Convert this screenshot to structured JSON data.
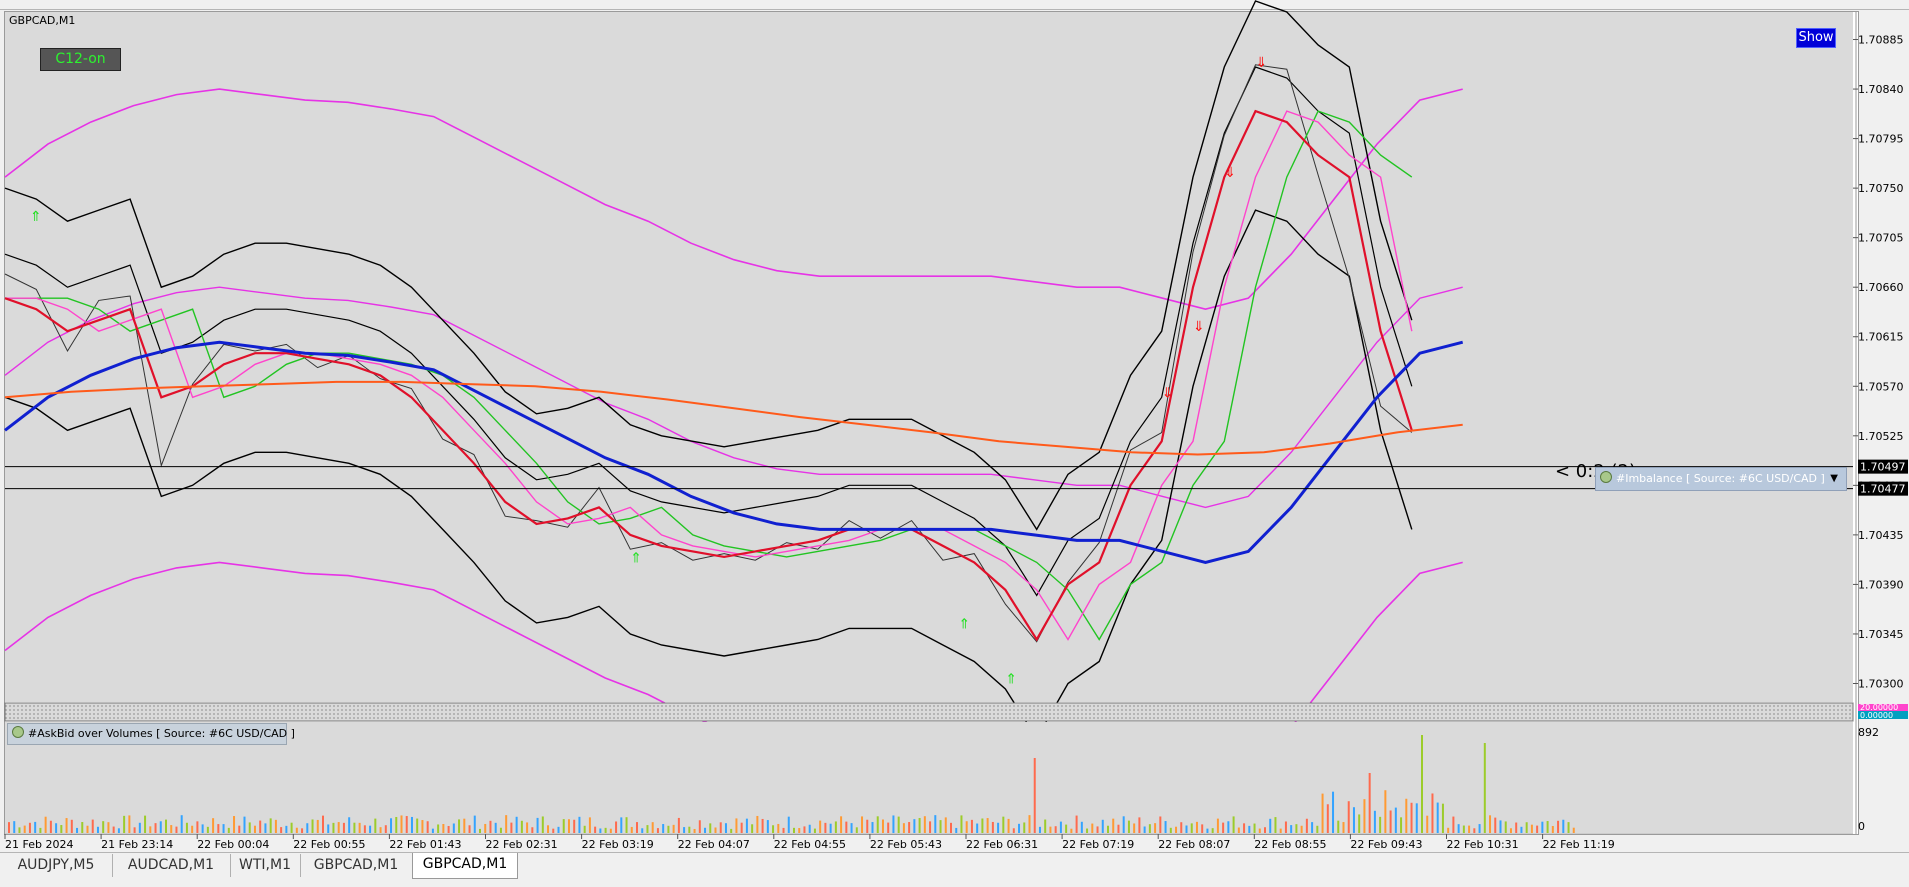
{
  "window": {
    "symbol_title": "GBPCAD,M1"
  },
  "buttons": {
    "c12": "C12-on",
    "show": "Show"
  },
  "indicators": {
    "imbalance_label": "#Imbalance [ Source: #6C USD/CAD ]",
    "imbalance_text": "< 0:2 (2)",
    "subwindow_label": "#AskBid over Volumes [ Source: #6C USD/CAD ]",
    "subwindow_scale_max": "892",
    "subwindow_scale_min": "0",
    "strip_labels": [
      "20.00000",
      "0.00000"
    ]
  },
  "price_labels": {
    "bid": "1.70497",
    "ask": "1.70477"
  },
  "tabs": [
    {
      "label": "AUDJPY,M5",
      "active": false
    },
    {
      "label": "AUDCAD,M1",
      "active": false
    },
    {
      "label": "WTI,M1",
      "active": false
    },
    {
      "label": "GBPCAD,M1",
      "active": false
    },
    {
      "label": "GBPCAD,M1",
      "active": true
    }
  ],
  "colors": {
    "bollinger_outer": "#e633e6",
    "bollinger_inner": "#000000",
    "ma_blue": "#1020d0",
    "ma_orange": "#ff5a1a",
    "ma_red": "#e0102a",
    "ma_green": "#22c422",
    "ma_pink": "#ff44cc",
    "arrow_up": "#22e022",
    "arrow_down": "#ff1010",
    "price_line": "#000000"
  },
  "chart_data": {
    "type": "line",
    "title": "GBPCAD,M1",
    "xlabel": "",
    "ylabel": "",
    "ylim": [
      1.70285,
      1.7091
    ],
    "y_ticks": [
      "1.70885",
      "1.70840",
      "1.70795",
      "1.70750",
      "1.70705",
      "1.70660",
      "1.70615",
      "1.70570",
      "1.70525",
      "1.70480",
      "1.70435",
      "1.70390",
      "1.70345",
      "1.70300"
    ],
    "x_ticks": [
      "21 Feb 2024",
      "21 Feb 23:14",
      "22 Feb 00:04",
      "22 Feb 00:55",
      "22 Feb 01:43",
      "22 Feb 02:31",
      "22 Feb 03:19",
      "22 Feb 04:07",
      "22 Feb 04:55",
      "22 Feb 05:43",
      "22 Feb 06:31",
      "22 Feb 07:19",
      "22 Feb 08:07",
      "22 Feb 08:55",
      "22 Feb 09:43",
      "22 Feb 10:31",
      "22 Feb 11:19"
    ],
    "x_index": [
      0,
      4,
      8,
      12,
      16,
      20,
      24,
      28,
      32,
      36,
      40,
      44,
      48,
      52,
      56,
      60,
      64
    ],
    "grid": false,
    "horizontal_lines": [
      1.70497,
      1.70477
    ],
    "series": [
      {
        "name": "price",
        "values": [
          1.7068,
          1.7065,
          1.7061,
          1.7064,
          1.7066,
          1.7049,
          1.7058,
          1.706,
          1.7061,
          1.706,
          1.70595,
          1.7059,
          1.70585,
          1.7056,
          1.7053,
          1.705,
          1.7046,
          1.7044,
          1.7045,
          1.7047,
          1.7043,
          1.7042,
          1.7042,
          1.7041,
          1.7042,
          1.7042,
          1.7043,
          1.7044,
          1.7044,
          1.7044,
          1.7042,
          1.7041,
          1.7038,
          1.7033,
          1.704,
          1.7042,
          1.7052,
          1.7052,
          1.707,
          1.7079,
          1.7087,
          1.7085,
          1.7077,
          1.7066,
          1.7056,
          1.7052
        ]
      },
      {
        "name": "ma_red",
        "values": [
          1.7065,
          1.7064,
          1.7062,
          1.7063,
          1.7064,
          1.7056,
          1.7057,
          1.7059,
          1.706,
          1.706,
          1.70595,
          1.7059,
          1.7058,
          1.7056,
          1.7053,
          1.705,
          1.70465,
          1.70445,
          1.7045,
          1.7046,
          1.70435,
          1.70425,
          1.7042,
          1.70415,
          1.7042,
          1.70425,
          1.7043,
          1.7044,
          1.7044,
          1.7044,
          1.70425,
          1.7041,
          1.70385,
          1.7034,
          1.7039,
          1.7041,
          1.7048,
          1.7052,
          1.7066,
          1.7076,
          1.7082,
          1.7081,
          1.7078,
          1.7076,
          1.7062,
          1.7053
        ]
      },
      {
        "name": "ma_blue",
        "values": [
          1.7053,
          1.7056,
          1.7058,
          1.70595,
          1.70605,
          1.7061,
          1.70605,
          1.706,
          1.70598,
          1.70592,
          1.70585,
          1.70565,
          1.70545,
          1.70525,
          1.70505,
          1.7049,
          1.7047,
          1.70455,
          1.70445,
          1.7044,
          1.7044,
          1.7044,
          1.7044,
          1.7044,
          1.70435,
          1.7043,
          1.7043,
          1.7042,
          1.7041,
          1.7042,
          1.7046,
          1.7051,
          1.7056,
          1.706,
          1.7061
        ]
      },
      {
        "name": "ma_orange",
        "values": [
          1.7056,
          1.70565,
          1.70568,
          1.7057,
          1.70572,
          1.70574,
          1.70574,
          1.70572,
          1.7057,
          1.70565,
          1.70558,
          1.7055,
          1.70542,
          1.70535,
          1.70528,
          1.7052,
          1.70515,
          1.7051,
          1.70508,
          1.7051,
          1.70518,
          1.70528,
          1.70535
        ]
      }
    ]
  }
}
